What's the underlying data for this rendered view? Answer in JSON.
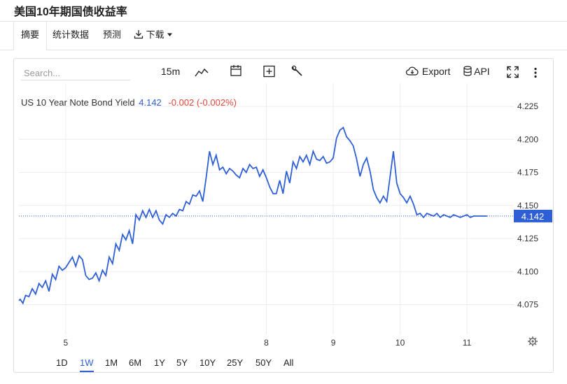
{
  "page_title": "美国10年期国债收益率",
  "tabs": [
    {
      "label": "摘要",
      "active": true
    },
    {
      "label": "统计数据"
    },
    {
      "label": "预测"
    },
    {
      "label": "下载"
    }
  ],
  "toolbar": {
    "search_placeholder": "Search...",
    "interval": "15m",
    "export_label": "Export",
    "api_label": "API"
  },
  "legend": {
    "name": "US 10 Year Note Bond Yield",
    "value": "4.142",
    "change": "-0.002 (-0.002%)"
  },
  "price_tag": "4.142",
  "ranges": [
    "1D",
    "1W",
    "1M",
    "6M",
    "1Y",
    "5Y",
    "10Y",
    "25Y",
    "50Y",
    "All"
  ],
  "active_range": "1W",
  "colors": {
    "line": "#2f5fd6",
    "negative": "#e0473c",
    "grid": "#ececec"
  },
  "chart_data": {
    "type": "line",
    "title": "",
    "xlabel": "",
    "ylabel": "",
    "ylim": [
      4.0525,
      4.2425
    ],
    "yticks": [
      4.075,
      4.1,
      4.125,
      4.15,
      4.175,
      4.2,
      4.225
    ],
    "xlim": [
      4.3,
      11.7
    ],
    "xticks": [
      {
        "value": 5,
        "label": "5"
      },
      {
        "value": 8,
        "label": "8"
      },
      {
        "value": 9,
        "label": "9"
      },
      {
        "value": 10,
        "label": "10"
      },
      {
        "value": 11,
        "label": "11"
      }
    ],
    "last_value": 4.142,
    "series": [
      {
        "x": [
          4.3,
          4.32,
          4.36,
          4.4,
          4.45,
          4.5,
          4.55,
          4.6,
          4.65,
          4.7,
          4.75,
          4.8,
          4.85,
          4.9,
          4.95,
          5.0,
          5.05,
          5.1,
          5.15,
          5.2,
          5.25,
          5.3,
          5.35,
          5.4,
          5.45,
          5.5,
          5.55,
          5.6,
          5.65,
          5.7,
          5.75,
          5.8,
          5.85,
          5.9,
          5.95,
          6.0,
          6.05,
          6.1,
          6.15,
          6.2,
          6.25,
          6.3,
          6.35,
          6.4,
          6.45,
          6.5,
          6.55,
          6.6,
          6.65,
          6.7,
          6.75,
          6.8,
          6.85,
          6.9,
          6.95,
          7.0,
          7.05,
          7.1,
          7.15,
          7.2,
          7.25,
          7.3,
          7.35,
          7.4,
          7.45,
          7.5,
          7.55,
          7.6,
          7.65,
          7.7,
          7.75,
          7.8,
          7.85,
          7.9,
          7.95,
          8.0,
          8.05,
          8.1,
          8.15,
          8.2,
          8.25,
          8.3,
          8.35,
          8.4,
          8.45,
          8.5,
          8.55,
          8.6,
          8.65,
          8.7,
          8.75,
          8.8,
          8.85,
          8.9,
          8.95,
          9.0,
          9.05,
          9.1,
          9.15,
          9.2,
          9.25,
          9.3,
          9.35,
          9.4,
          9.45,
          9.5,
          9.55,
          9.6,
          9.65,
          9.7,
          9.75,
          9.8,
          9.85,
          9.9,
          9.95,
          10.0,
          10.05,
          10.1,
          10.15,
          10.2,
          10.25,
          10.3,
          10.35,
          10.4,
          10.45,
          10.5,
          10.55,
          10.6,
          10.65,
          10.7,
          10.75,
          10.8,
          10.85,
          10.9,
          10.95,
          11.0,
          11.05,
          11.1,
          11.15,
          11.2,
          11.25,
          11.3
        ],
        "y": [
          4.078,
          4.079,
          4.076,
          4.082,
          4.081,
          4.087,
          4.083,
          4.091,
          4.088,
          4.093,
          4.085,
          4.098,
          4.094,
          4.104,
          4.101,
          4.103,
          4.107,
          4.111,
          4.104,
          4.112,
          4.109,
          4.097,
          4.094,
          4.095,
          4.099,
          4.093,
          4.101,
          4.097,
          4.111,
          4.106,
          4.121,
          4.116,
          4.128,
          4.124,
          4.131,
          4.121,
          4.143,
          4.139,
          4.146,
          4.141,
          4.147,
          4.141,
          4.146,
          4.139,
          4.136,
          4.143,
          4.141,
          4.144,
          4.142,
          4.147,
          4.146,
          4.153,
          4.151,
          4.158,
          4.157,
          4.161,
          4.153,
          4.171,
          4.191,
          4.181,
          4.188,
          4.177,
          4.179,
          4.174,
          4.178,
          4.176,
          4.173,
          4.171,
          4.178,
          4.175,
          4.181,
          4.178,
          4.179,
          4.172,
          4.177,
          4.171,
          4.164,
          4.159,
          4.159,
          4.169,
          4.159,
          4.176,
          4.167,
          4.183,
          4.178,
          4.187,
          4.183,
          4.188,
          4.181,
          4.191,
          4.185,
          4.184,
          4.187,
          4.182,
          4.183,
          4.186,
          4.201,
          4.207,
          4.209,
          4.202,
          4.199,
          4.195,
          4.185,
          4.172,
          4.181,
          4.186,
          4.176,
          4.162,
          4.156,
          4.152,
          4.157,
          4.153,
          4.172,
          4.191,
          4.167,
          4.159,
          4.156,
          4.152,
          4.157,
          4.151,
          4.143,
          4.144,
          4.141,
          4.144,
          4.143,
          4.142,
          4.144,
          4.141,
          4.143,
          4.142,
          4.141,
          4.143,
          4.142,
          4.141,
          4.142,
          4.143,
          4.141,
          4.142,
          4.142,
          4.142,
          4.142,
          4.142
        ]
      }
    ]
  }
}
